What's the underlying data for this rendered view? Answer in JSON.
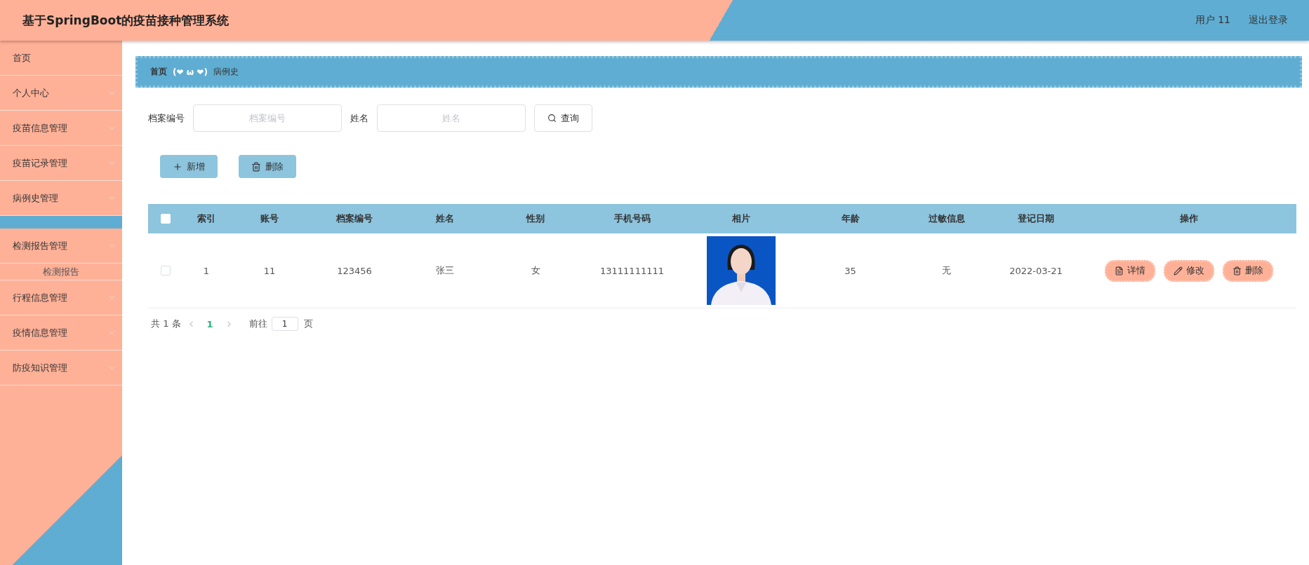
{
  "header": {
    "title": "基于SpringBoot的疫苗接种管理系统",
    "user": "用户 11",
    "logout": "退出登录"
  },
  "sidebar": {
    "items": [
      {
        "label": "首页",
        "has_arrow": false,
        "expanded": false
      },
      {
        "label": "个人中心",
        "has_arrow": true,
        "expanded": false
      },
      {
        "label": "疫苗信息管理",
        "has_arrow": true,
        "expanded": false
      },
      {
        "label": "疫苗记录管理",
        "has_arrow": true,
        "expanded": false
      },
      {
        "label": "病例史管理",
        "has_arrow": true,
        "expanded": true
      },
      {
        "label": "检测报告管理",
        "has_arrow": true,
        "expanded": true,
        "children": [
          {
            "label": "检测报告"
          }
        ]
      },
      {
        "label": "行程信息管理",
        "has_arrow": true,
        "expanded": false
      },
      {
        "label": "疫情信息管理",
        "has_arrow": true,
        "expanded": false
      },
      {
        "label": "防疫知识管理",
        "has_arrow": true,
        "expanded": false
      }
    ]
  },
  "breadcrumb": {
    "home": "首页",
    "separator": "(❤ ω ❤)",
    "current": "病例史"
  },
  "search": {
    "fields": [
      {
        "label": "档案编号",
        "placeholder": "档案编号"
      },
      {
        "label": "姓名",
        "placeholder": "姓名"
      }
    ],
    "button": "查询"
  },
  "actions": [
    {
      "kind": "add",
      "label": "新增"
    },
    {
      "kind": "delete",
      "label": "删除"
    }
  ],
  "table": {
    "columns": [
      "索引",
      "账号",
      "档案编号",
      "姓名",
      "性别",
      "手机号码",
      "相片",
      "年龄",
      "过敏信息",
      "登记日期",
      "操作"
    ],
    "rows": [
      {
        "checked": false,
        "cells": [
          "1",
          "11",
          "123456",
          "张三",
          "女",
          "13111111111",
          {
            "kind": "picture"
          },
          "35",
          "无",
          "2022-03-21"
        ],
        "buttons": [
          {
            "kind": "detail",
            "label": "详情"
          },
          {
            "kind": "edit",
            "label": "修改"
          },
          {
            "kind": "delete",
            "label": "删除"
          }
        ]
      }
    ],
    "header_checked": false
  },
  "pagination": {
    "total": "共 1 条",
    "pages": [
      {
        "label": "1",
        "selected": true
      }
    ],
    "goto": "前往",
    "page_input": "1",
    "page_suffix": "页"
  }
}
